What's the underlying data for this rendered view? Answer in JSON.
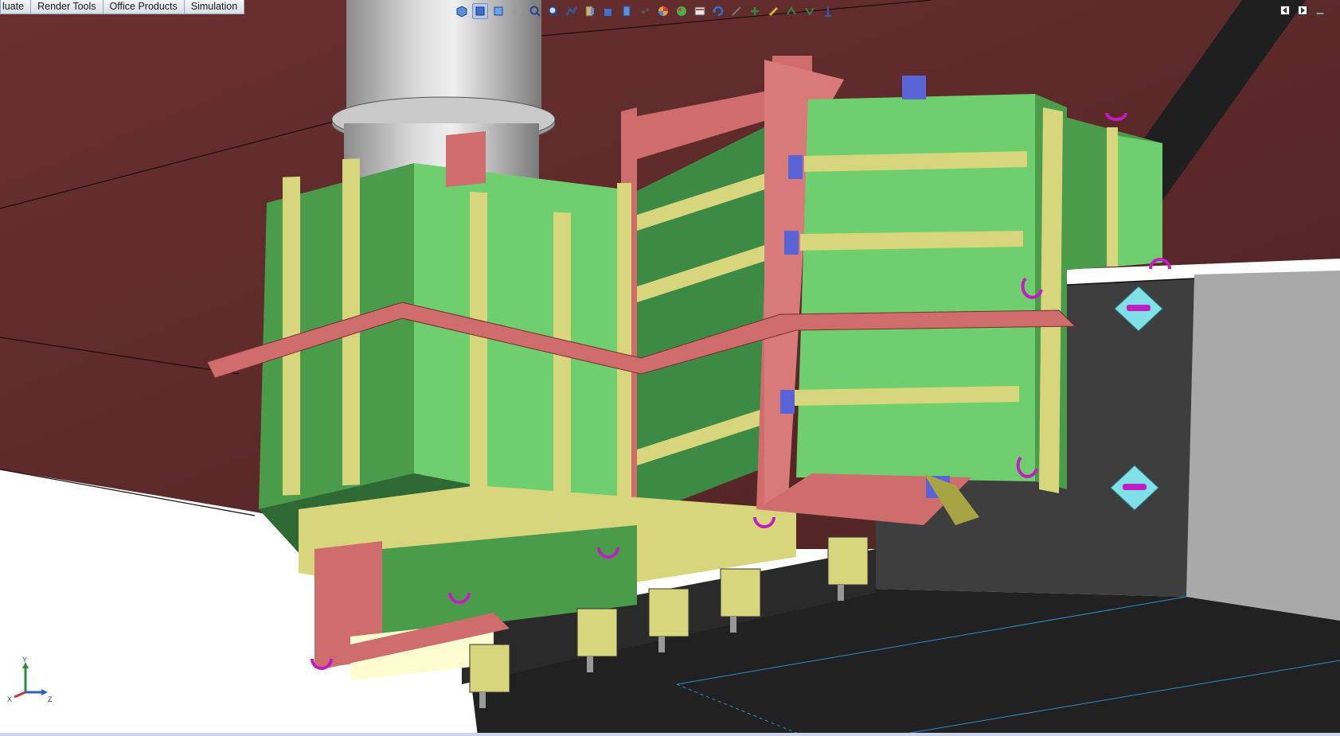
{
  "menu_tabs": [
    {
      "label": "luate"
    },
    {
      "label": "Render Tools"
    },
    {
      "label": "Office Products"
    },
    {
      "label": "Simulation"
    }
  ],
  "toolbar_icons": [
    "isometric-view-icon",
    "display-style-icon",
    "shaded-view-icon",
    "hidden-lines-icon",
    "zoom-to-fit-icon",
    "zoom-area-icon",
    "sketch-icon",
    "section-view-icon",
    "view-cube-icon",
    "hide-show-icon",
    "appearance-icon",
    "scene-icon",
    "render-icon",
    "rotate-icon",
    "select-icon",
    "feature-icon",
    "edit-icon",
    "reference-icon",
    "dimension-icon",
    "relation-icon",
    "coordinate-icon"
  ],
  "window_controls": [
    "tile-left-icon",
    "tile-right-icon",
    "minimize-icon"
  ],
  "triad": {
    "y": "Y",
    "x": "X",
    "z": "Z"
  },
  "colors": {
    "hull": "#5e2a2a",
    "frame": "#cf6c6c",
    "box_green": "#6fcf6f",
    "strap_yellow": "#d8d67c",
    "shadow_green": "#2f6a34",
    "pipe": "#bdbdbd",
    "hook": "#c21dc2",
    "base_dark": "#3b3b3b"
  }
}
